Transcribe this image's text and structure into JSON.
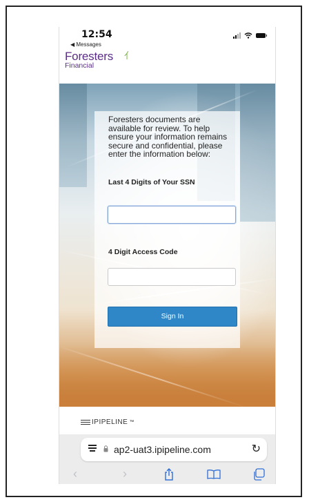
{
  "status_bar": {
    "time": "12:54",
    "back_app": "◀ Messages"
  },
  "logo": {
    "name": "Foresters",
    "sub": "Financial"
  },
  "form": {
    "intro": "Foresters documents are available for review. To help ensure your information remains secure and confidential, please enter the information below:",
    "ssn_label": "Last 4 Digits of Your SSN",
    "ssn_value": "",
    "code_label": "4 Digit Access Code",
    "code_value": "",
    "sign_in_label": "Sign In"
  },
  "footer": {
    "brand": "IPIPELINE",
    "brand_mark": "™"
  },
  "browser": {
    "url": "ap2-uat3.ipipeline.com",
    "icons": {
      "reader": "reader-mode-icon",
      "lock": "lock-icon",
      "reload": "reload-icon",
      "back": "chevron-left-icon",
      "forward": "chevron-right-icon",
      "share": "share-icon",
      "bookmarks": "book-icon",
      "tabs": "tabs-icon"
    }
  },
  "colors": {
    "brand_purple": "#5b2d86",
    "button_blue": "#2f87c8",
    "ios_blue": "#2f6fd6"
  }
}
